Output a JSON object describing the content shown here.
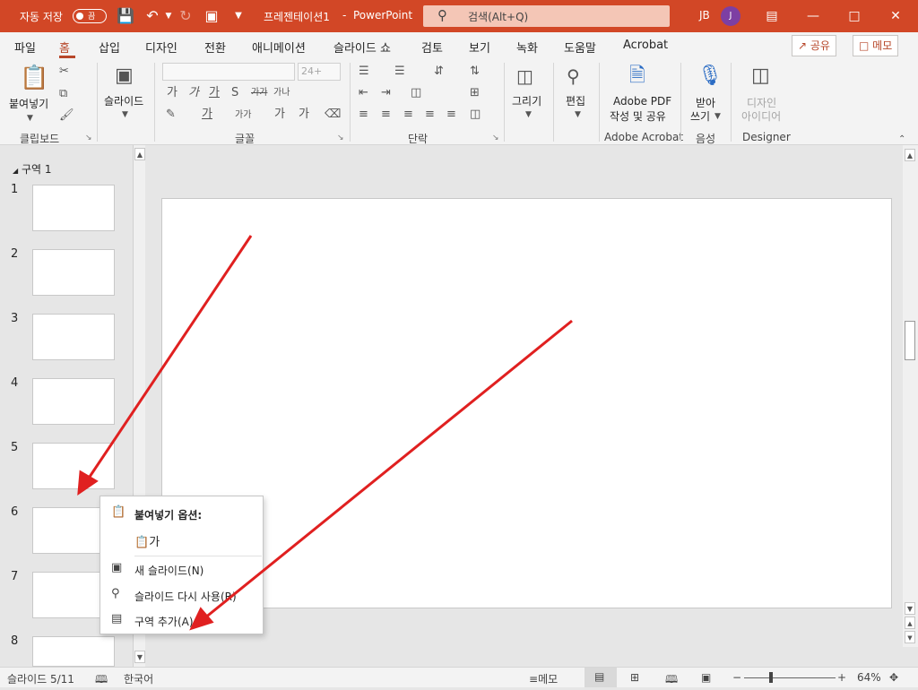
{
  "titlebar": {
    "autosave_label": "자동 저장",
    "autosave_toggle": "끔",
    "doc_title": "프레젠테이션1",
    "separator": "-",
    "app_name": "PowerPoint",
    "search_placeholder": "검색(Alt+Q)",
    "user_initials": "JB",
    "avatar_letter": "J"
  },
  "tabs": [
    "파일",
    "홈",
    "삽입",
    "디자인",
    "전환",
    "애니메이션",
    "슬라이드 쇼",
    "검토",
    "보기",
    "녹화",
    "도움말",
    "Acrobat"
  ],
  "active_tab": "홈",
  "header_buttons": {
    "share": "공유",
    "comments": "메모"
  },
  "ribbon": {
    "clipboard": {
      "paste_label": "붙여넣기",
      "group": "클립보드"
    },
    "slides": {
      "new_slide_label": "슬라이드",
      "group": ""
    },
    "font": {
      "size_value": "24+",
      "group": "글꼴"
    },
    "paragraph": {
      "group": "단락"
    },
    "drawing": {
      "label": "그리기"
    },
    "editing": {
      "label": "편집"
    },
    "adobe": {
      "line1": "Adobe PDF",
      "line2": "작성 및 공유",
      "group": "Adobe Acrobat"
    },
    "voice": {
      "line1": "받아",
      "line2": "쓰기",
      "group": "음성"
    },
    "designer": {
      "line1": "디자인",
      "line2": "아이디어",
      "group": "Designer"
    }
  },
  "panel": {
    "section_title": "구역 1",
    "slide_numbers": [
      "1",
      "2",
      "3",
      "4",
      "5",
      "6",
      "7",
      "8"
    ]
  },
  "context_menu": {
    "paste_options": "붙여넣기 옵션:",
    "paste_glyph": "가",
    "new_slide": "새 슬라이드(N)",
    "reuse_slides": "슬라이드 다시 사용(R)",
    "add_section": "구역 추가(A)"
  },
  "statusbar": {
    "slide_counter": "슬라이드 5/11",
    "language": "한국어",
    "notes": "메모",
    "zoom": "64%"
  },
  "colors": {
    "brand": "#d24726",
    "accent_text": "#b7472a",
    "annotation_arrow": "#e02020"
  }
}
